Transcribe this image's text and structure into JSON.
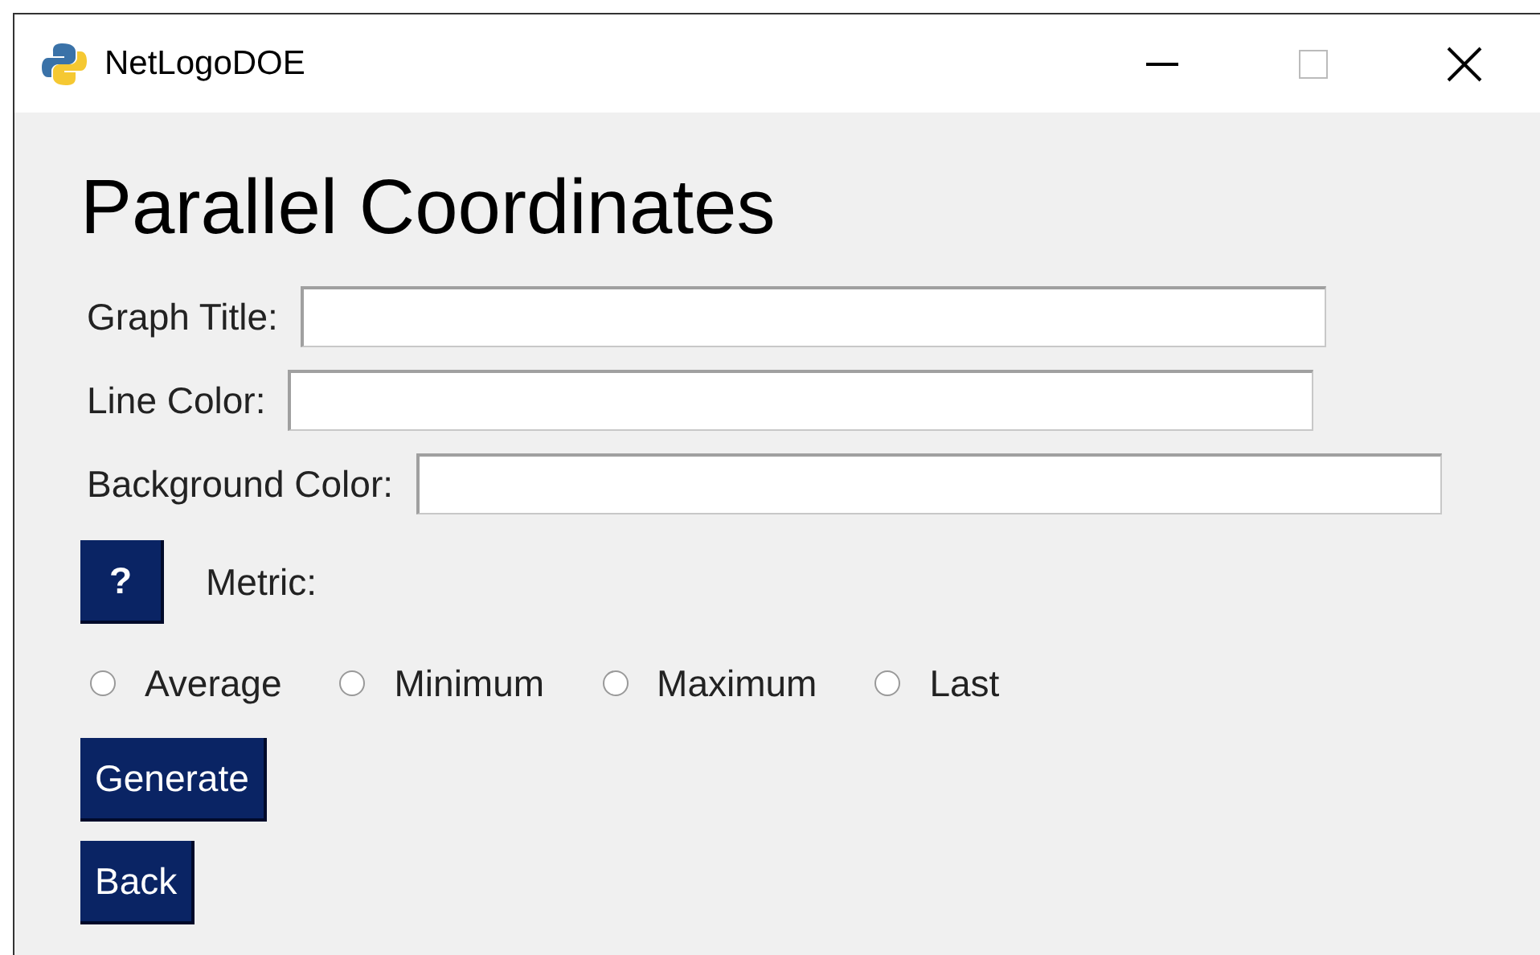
{
  "window": {
    "title": "NetLogoDOE"
  },
  "heading": "Parallel Coordinates",
  "fields": [
    {
      "label": "Graph Title:"
    },
    {
      "label": "Line Color:"
    },
    {
      "label": "Background Color:"
    }
  ],
  "help_button": "?",
  "metric_label": "Metric:",
  "metric_options": [
    {
      "label": "Average",
      "selected": false
    },
    {
      "label": "Minimum",
      "selected": false
    },
    {
      "label": "Maximum",
      "selected": false
    },
    {
      "label": "Last",
      "selected": false
    }
  ],
  "buttons": [
    "Generate",
    "Back"
  ]
}
